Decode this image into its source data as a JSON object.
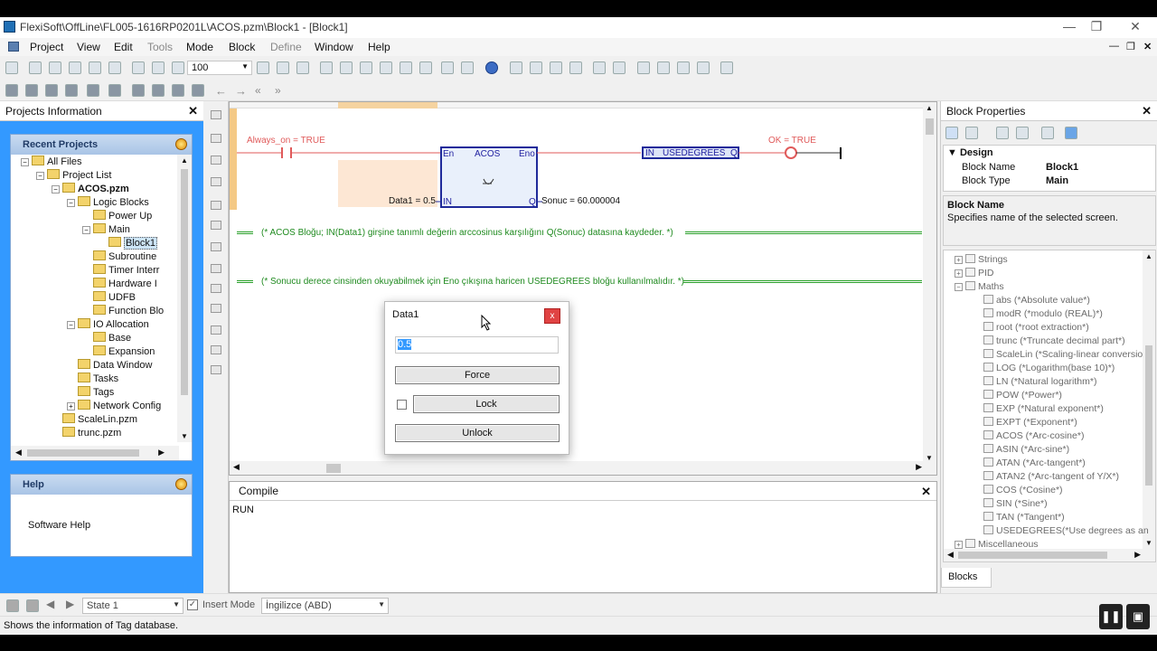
{
  "window": {
    "title": "FlexiSoft\\OffLine\\FL005-1616RP0201L\\ACOS.pzm\\Block1 - [Block1]"
  },
  "menu": [
    "Project",
    "View",
    "Edit",
    "Tools",
    "Mode",
    "Block",
    "Define",
    "Window",
    "Help"
  ],
  "toolbar": {
    "zoom_value": "100"
  },
  "projects_panel": {
    "title": "Projects Information",
    "recent_title": "Recent Projects",
    "tree": [
      {
        "label": "All Files",
        "indent": 0,
        "exp": "-"
      },
      {
        "label": "Project List",
        "indent": 1,
        "exp": "-"
      },
      {
        "label": "ACOS.pzm",
        "indent": 2,
        "exp": "-",
        "bold": true
      },
      {
        "label": "Logic Blocks",
        "indent": 3,
        "exp": "-"
      },
      {
        "label": "Power Up",
        "indent": 4,
        "exp": ""
      },
      {
        "label": "Main",
        "indent": 4,
        "exp": "-"
      },
      {
        "label": "Block1",
        "indent": 5,
        "exp": "",
        "selected": true
      },
      {
        "label": "Subroutine",
        "indent": 4,
        "exp": ""
      },
      {
        "label": "Timer Interr",
        "indent": 4,
        "exp": ""
      },
      {
        "label": "Hardware I",
        "indent": 4,
        "exp": ""
      },
      {
        "label": "UDFB",
        "indent": 4,
        "exp": ""
      },
      {
        "label": "Function Blo",
        "indent": 4,
        "exp": ""
      },
      {
        "label": "IO Allocation",
        "indent": 3,
        "exp": "-"
      },
      {
        "label": "Base",
        "indent": 4,
        "exp": ""
      },
      {
        "label": "Expansion",
        "indent": 4,
        "exp": ""
      },
      {
        "label": "Data Window",
        "indent": 3,
        "exp": ""
      },
      {
        "label": "Tasks",
        "indent": 3,
        "exp": ""
      },
      {
        "label": "Tags",
        "indent": 3,
        "exp": ""
      },
      {
        "label": "Network Config",
        "indent": 3,
        "exp": "+"
      },
      {
        "label": "ScaleLin.pzm",
        "indent": 2,
        "exp": ""
      },
      {
        "label": "trunc.pzm",
        "indent": 2,
        "exp": ""
      }
    ],
    "help_title": "Help",
    "help_link": "Software Help"
  },
  "ladder": {
    "contact_label": "Always_on = TRUE",
    "acos_title": "ACOS",
    "acos_en": "En",
    "acos_eno": "Eno",
    "acos_in": "IN",
    "acos_q": "Q",
    "data_in": "Data1 = 0.5",
    "data_out": "Sonuc = 60.000004",
    "usedeg_in": "IN",
    "usedeg_title": "USEDEGREES",
    "usedeg_q": "Q",
    "coil_label": "OK = TRUE",
    "comment1": "(* ACOS Bloğu; IN(Data1) girşine tanımlı değerin arccosinus karşılığını Q(Sonuc) datasına kaydeder. *)",
    "comment2": "(* Sonucu derece cinsinden okuyabilmek için Eno çıkışına  haricen USEDEGREES bloğu kullanılmalıdır. *)"
  },
  "dialog": {
    "title": "Data1",
    "close": "x",
    "value": "0.5",
    "force": "Force",
    "lock": "Lock",
    "unlock": "Unlock"
  },
  "compile": {
    "title": "Compile",
    "output": "RUN"
  },
  "block_properties": {
    "title": "Block Properties",
    "section": "Design",
    "name_label": "Block Name",
    "name_value": "Block1",
    "type_label": "Block Type",
    "type_value": "Main",
    "desc_title": "Block Name",
    "desc_text": "Specifies name of the selected screen.",
    "blocks": [
      {
        "label": "Strings",
        "folder": true,
        "exp": "+"
      },
      {
        "label": "PID",
        "folder": true,
        "exp": "+"
      },
      {
        "label": "Maths",
        "folder": true,
        "exp": "-"
      },
      {
        "label": "abs (*Absolute value*)"
      },
      {
        "label": "modR (*modulo (REAL)*)"
      },
      {
        "label": "root (*root extraction*)"
      },
      {
        "label": "trunc (*Truncate decimal part*)"
      },
      {
        "label": "ScaleLin (*Scaling-linear conversio"
      },
      {
        "label": "LOG (*Logarithm(base 10)*)"
      },
      {
        "label": "LN (*Natural logarithm*)"
      },
      {
        "label": "POW (*Power*)"
      },
      {
        "label": "EXP (*Natural exponent*)"
      },
      {
        "label": "EXPT (*Exponent*)"
      },
      {
        "label": "ACOS (*Arc-cosine*)"
      },
      {
        "label": "ASIN (*Arc-sine*)"
      },
      {
        "label": "ATAN (*Arc-tangent*)"
      },
      {
        "label": "ATAN2 (*Arc-tangent of Y/X*)"
      },
      {
        "label": "COS (*Cosine*)"
      },
      {
        "label": "SIN (*Sine*)"
      },
      {
        "label": "TAN (*Tangent*)"
      },
      {
        "label": "USEDEGREES(*Use degrees as an"
      },
      {
        "label": "Miscellaneous",
        "folder": true,
        "exp": "+"
      }
    ],
    "tab": "Blocks"
  },
  "status": {
    "state": "State 1",
    "insert_mode": "Insert Mode",
    "language": "İngilizce (ABD)",
    "message": "Shows the information of Tag database."
  }
}
